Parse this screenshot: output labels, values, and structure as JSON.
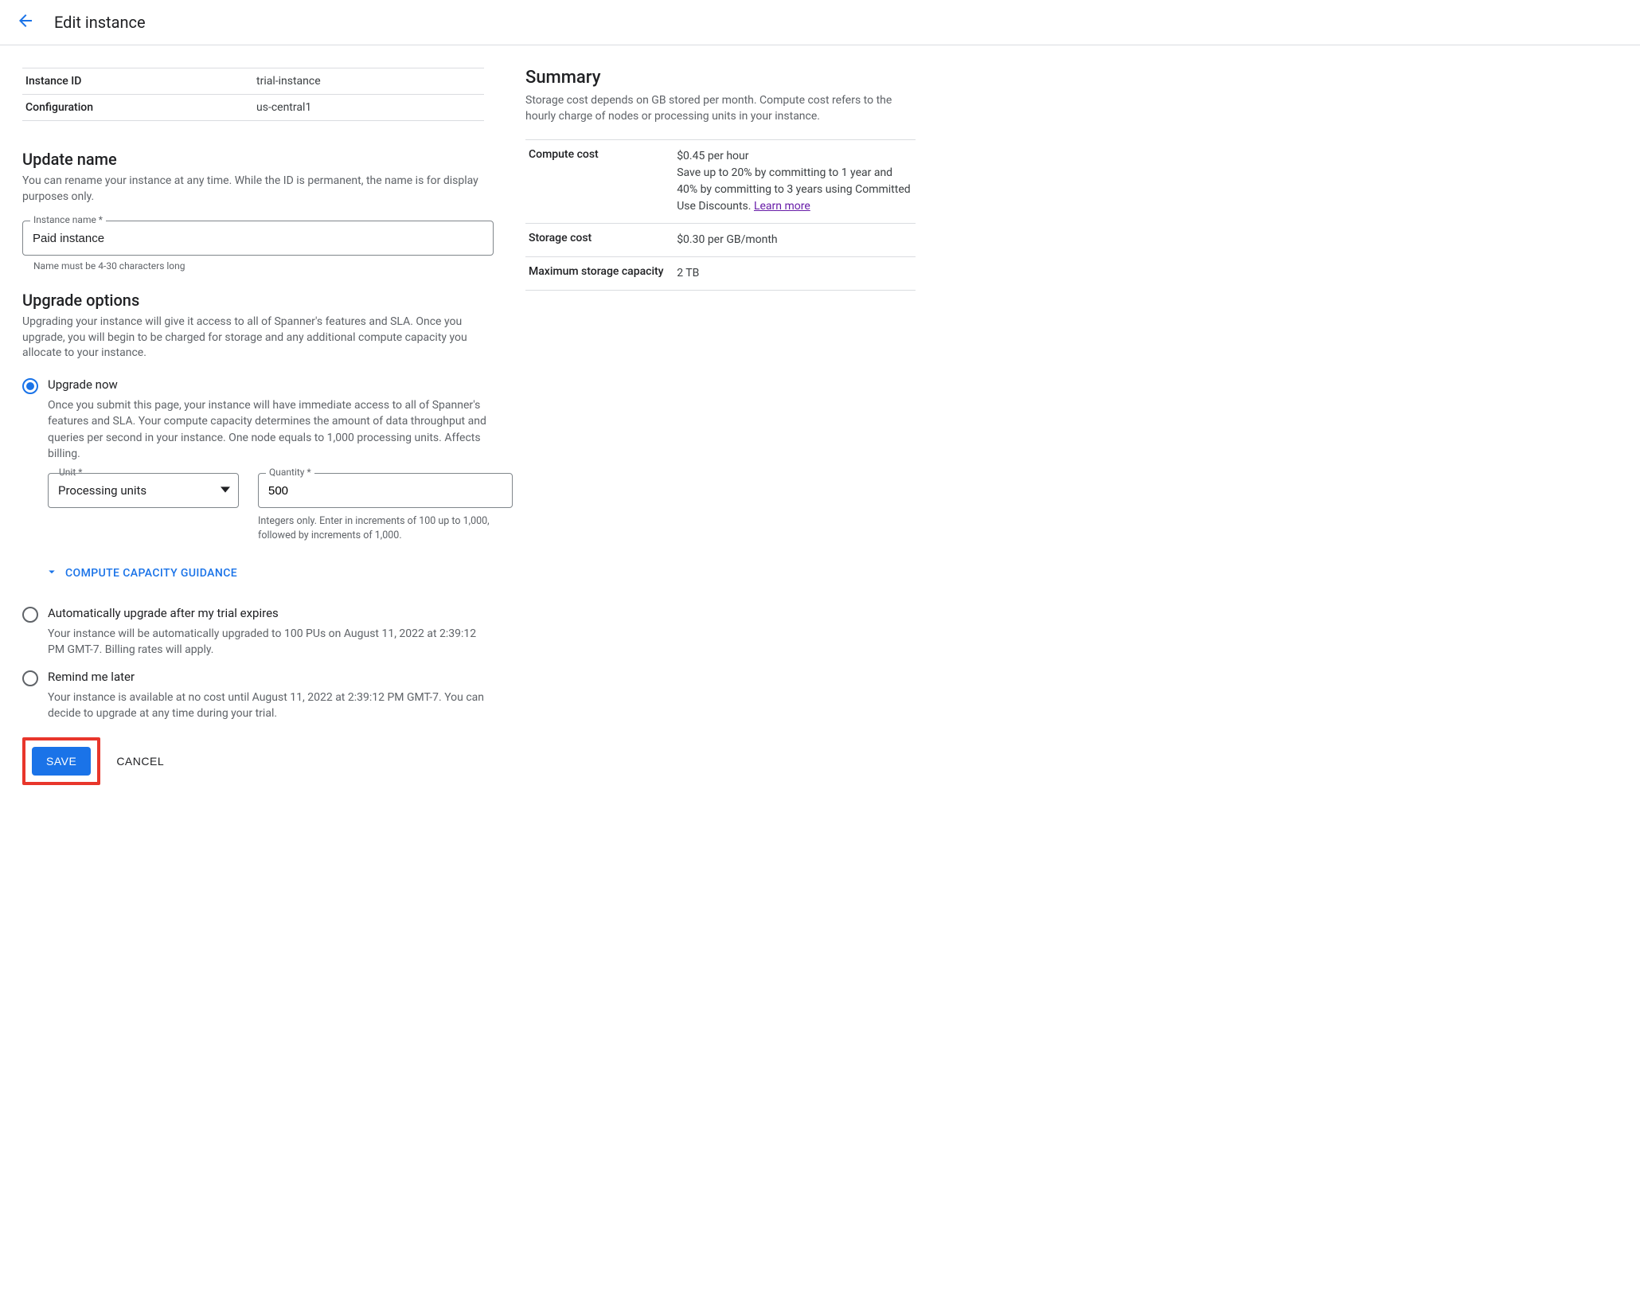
{
  "header": {
    "title": "Edit instance"
  },
  "instance": {
    "id_label": "Instance ID",
    "id_value": "trial-instance",
    "config_label": "Configuration",
    "config_value": "us-central1"
  },
  "update_name": {
    "title": "Update name",
    "desc": "You can rename your instance at any time. While the ID is permanent, the name is for display purposes only.",
    "field_label": "Instance name *",
    "field_value": "Paid instance",
    "field_hint": "Name must be 4-30 characters long"
  },
  "upgrade": {
    "title": "Upgrade options",
    "desc": "Upgrading your instance will give it access to all of Spanner's features and SLA. Once you upgrade, you will begin to be charged for storage and any additional compute capacity you allocate to your instance.",
    "options": {
      "now": {
        "label": "Upgrade now",
        "desc": "Once you submit this page, your instance will have immediate access to all of Spanner's features and SLA. Your compute capacity determines the amount of data throughput and queries per second in your instance. One node equals to 1,000 processing units. Affects billing.",
        "unit_label": "Unit *",
        "unit_value": "Processing units",
        "qty_label": "Quantity *",
        "qty_value": "500",
        "qty_hint": "Integers only. Enter in increments of 100 up to 1,000, followed by increments of 1,000."
      },
      "auto": {
        "label": "Automatically upgrade after my trial expires",
        "desc": "Your instance will be automatically upgraded to 100 PUs on August 11, 2022 at 2:39:12 PM GMT-7. Billing rates will apply."
      },
      "remind": {
        "label": "Remind me later",
        "desc": "Your instance is available at no cost until August 11, 2022 at 2:39:12 PM GMT-7. You can decide to upgrade at any time during your trial."
      }
    },
    "guidance_label": "COMPUTE CAPACITY GUIDANCE"
  },
  "buttons": {
    "save": "SAVE",
    "cancel": "CANCEL"
  },
  "summary": {
    "title": "Summary",
    "desc": "Storage cost depends on GB stored per month. Compute cost refers to the hourly charge of nodes or processing units in your instance.",
    "compute_label": "Compute cost",
    "compute_value": "$0.45 per hour",
    "compute_extra": "Save up to 20% by committing to 1 year and 40% by committing to 3 years using Committed Use Discounts. ",
    "learn_more": "Learn more",
    "storage_label": "Storage cost",
    "storage_value": "$0.30 per GB/month",
    "max_label": "Maximum storage capacity",
    "max_value": "2 TB"
  }
}
